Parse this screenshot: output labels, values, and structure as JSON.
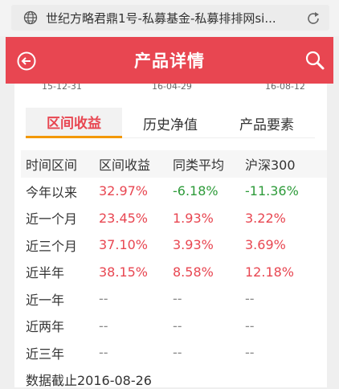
{
  "browser": {
    "url_text": "世纪方略君鼎1号-私募基金-私募排排网si..."
  },
  "appbar": {
    "title": "产品详情"
  },
  "date_axis": [
    "15-12-31",
    "16-04-29",
    "16-08-12"
  ],
  "tabs": [
    {
      "label": "区间收益",
      "active": true
    },
    {
      "label": "历史净值",
      "active": false
    },
    {
      "label": "产品要素",
      "active": false
    }
  ],
  "table": {
    "headers": [
      "时间区间",
      "区间收益",
      "同类平均",
      "沪深300"
    ],
    "rows": [
      {
        "period": "今年以来",
        "return": "32.97%",
        "avg": "-6.18%",
        "hs300": "-11.36%"
      },
      {
        "period": "近一个月",
        "return": "23.45%",
        "avg": "1.93%",
        "hs300": "3.22%"
      },
      {
        "period": "近三个月",
        "return": "37.10%",
        "avg": "3.93%",
        "hs300": "3.69%"
      },
      {
        "period": "近半年",
        "return": "38.15%",
        "avg": "8.58%",
        "hs300": "12.18%"
      },
      {
        "period": "近一年",
        "return": "--",
        "avg": "--",
        "hs300": "--"
      },
      {
        "period": "近两年",
        "return": "--",
        "avg": "--",
        "hs300": "--"
      },
      {
        "period": "近三年",
        "return": "--",
        "avg": "--",
        "hs300": "--"
      }
    ]
  },
  "footnote": "数据截止2016-08-26",
  "colors": {
    "accent": "#e84651",
    "tab_underline": "#f39800",
    "positive": "#e84651",
    "negative": "#2e9b3a"
  },
  "icons": {
    "url_bar": "globe-icon",
    "reload": "reload-icon",
    "back": "back-icon",
    "search": "search-icon"
  }
}
